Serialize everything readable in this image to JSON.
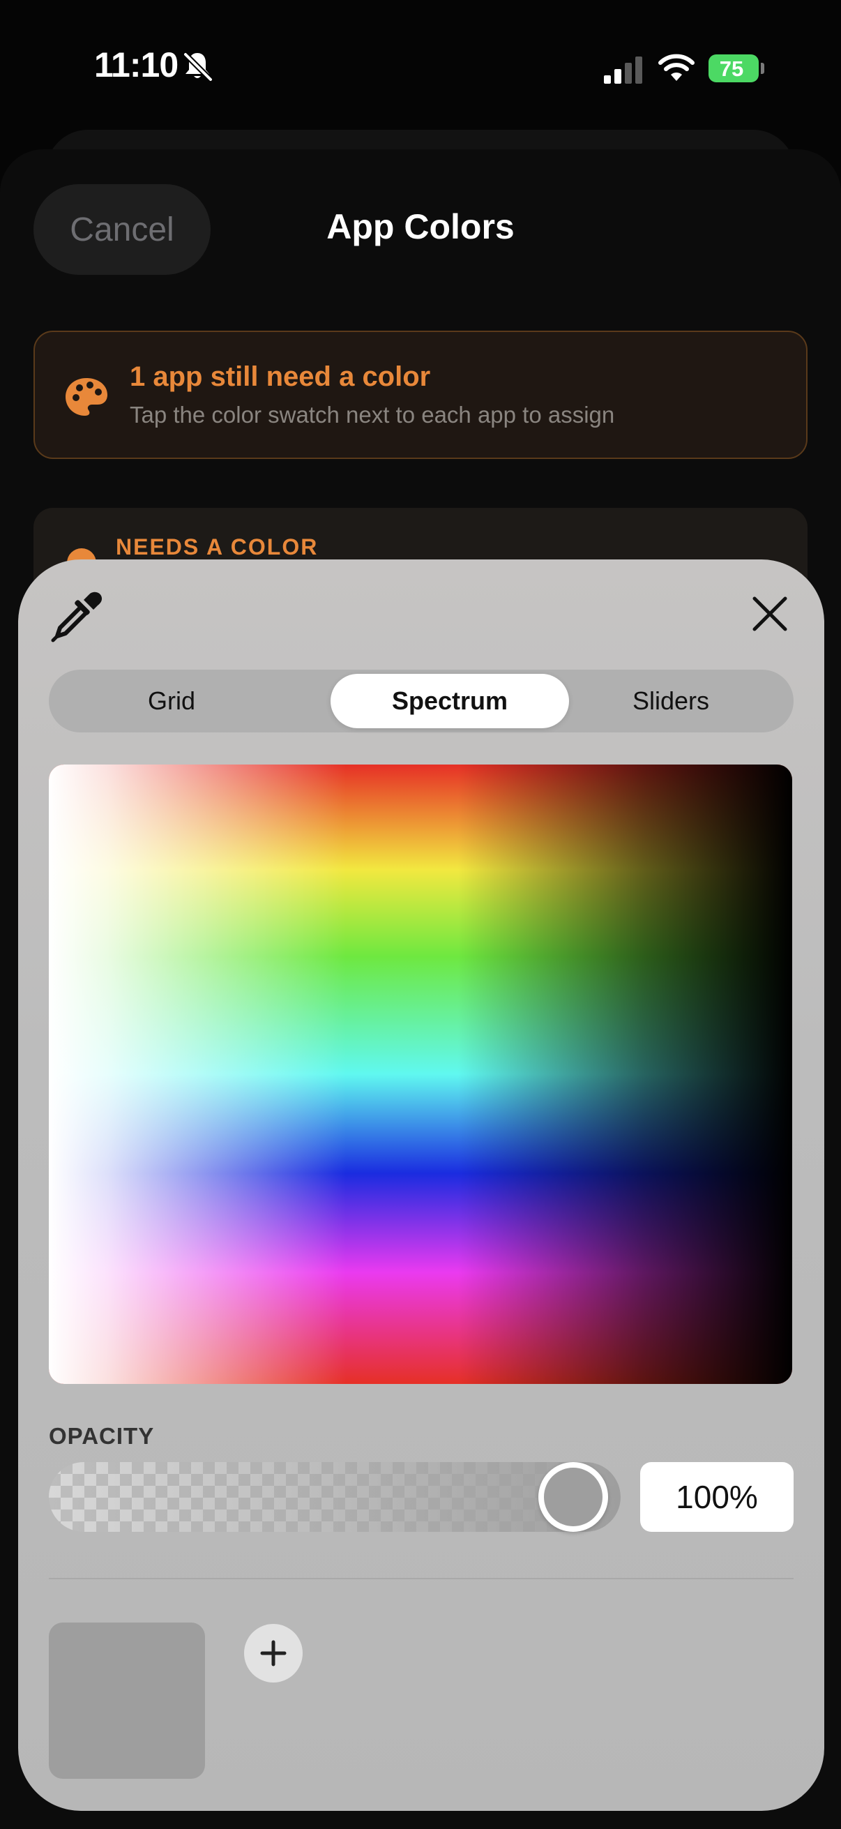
{
  "status_bar": {
    "time": "11:10",
    "battery": "75"
  },
  "sheet": {
    "cancel_label": "Cancel",
    "title": "App Colors"
  },
  "notice": {
    "title": "1 app still need a color",
    "subtitle": "Tap the color swatch next to each app to assign",
    "accent_color": "#e8883a"
  },
  "section": {
    "needs_header": "NEEDS A COLOR"
  },
  "picker": {
    "tabs": [
      {
        "label": "Grid",
        "selected": false
      },
      {
        "label": "Spectrum",
        "selected": true
      },
      {
        "label": "Sliders",
        "selected": false
      }
    ],
    "opacity": {
      "label": "OPACITY",
      "value_text": "100%",
      "value": 100
    },
    "current_color": "#9e9e9e",
    "icons": [
      "eyedropper-icon",
      "close-icon",
      "plus-icon"
    ]
  }
}
